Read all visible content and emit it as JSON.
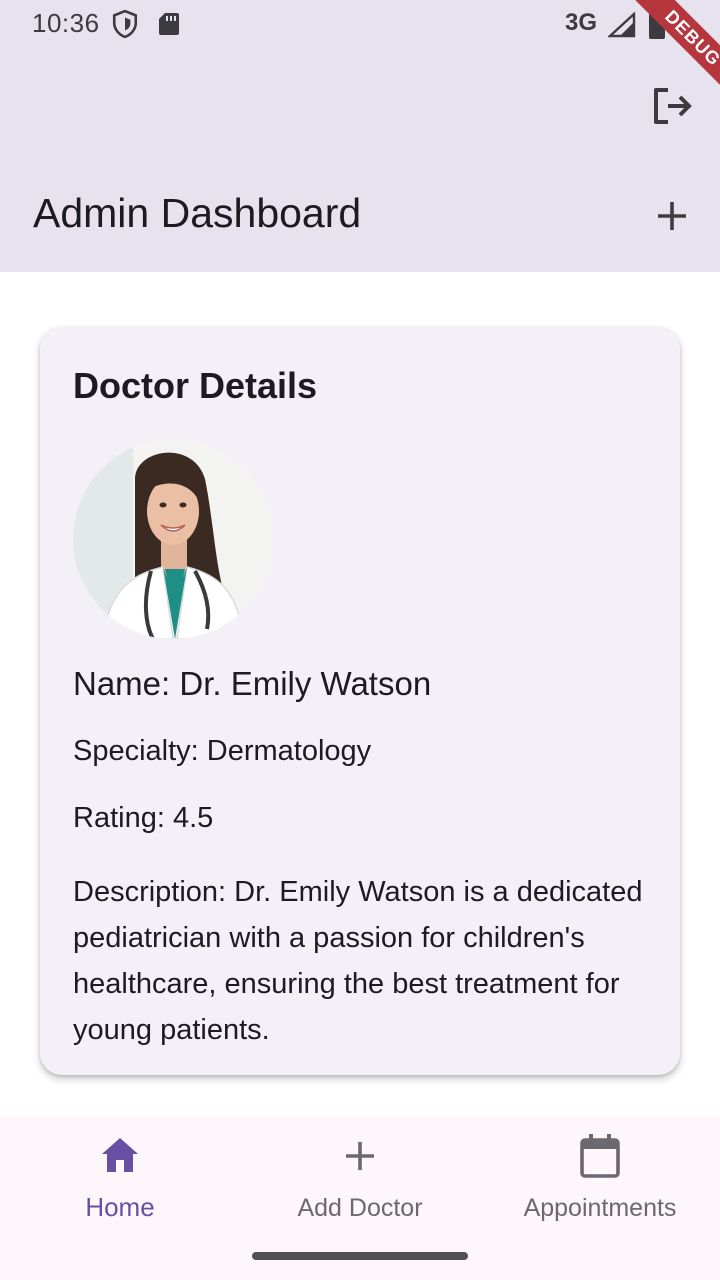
{
  "status_bar": {
    "time": "10:36",
    "network": "3G",
    "icons": [
      "shield-icon",
      "sd-card-icon",
      "signal-icon",
      "battery-icon"
    ]
  },
  "debug_banner": "DEBUG",
  "app_bar": {
    "title": "Admin Dashboard",
    "actions": [
      "logout-icon",
      "add-icon"
    ],
    "background": "#e8e2ef"
  },
  "card": {
    "title": "Doctor Details",
    "name": "Name: Dr. Emily Watson",
    "specialty": "Specialty: Dermatology",
    "rating": "Rating: 4.5",
    "description": "Description: Dr. Emily Watson is a dedicated pediatrician with a passion for children's healthcare, ensuring the best treatment for young patients.",
    "photo": "doctor-photo"
  },
  "bottom_nav": {
    "items": [
      {
        "label": "Home",
        "icon": "home-icon",
        "active": true
      },
      {
        "label": "Add Doctor",
        "icon": "add-icon",
        "active": false
      },
      {
        "label": "Appointments",
        "icon": "calendar-icon",
        "active": false
      }
    ],
    "accent": "#6750a4"
  }
}
